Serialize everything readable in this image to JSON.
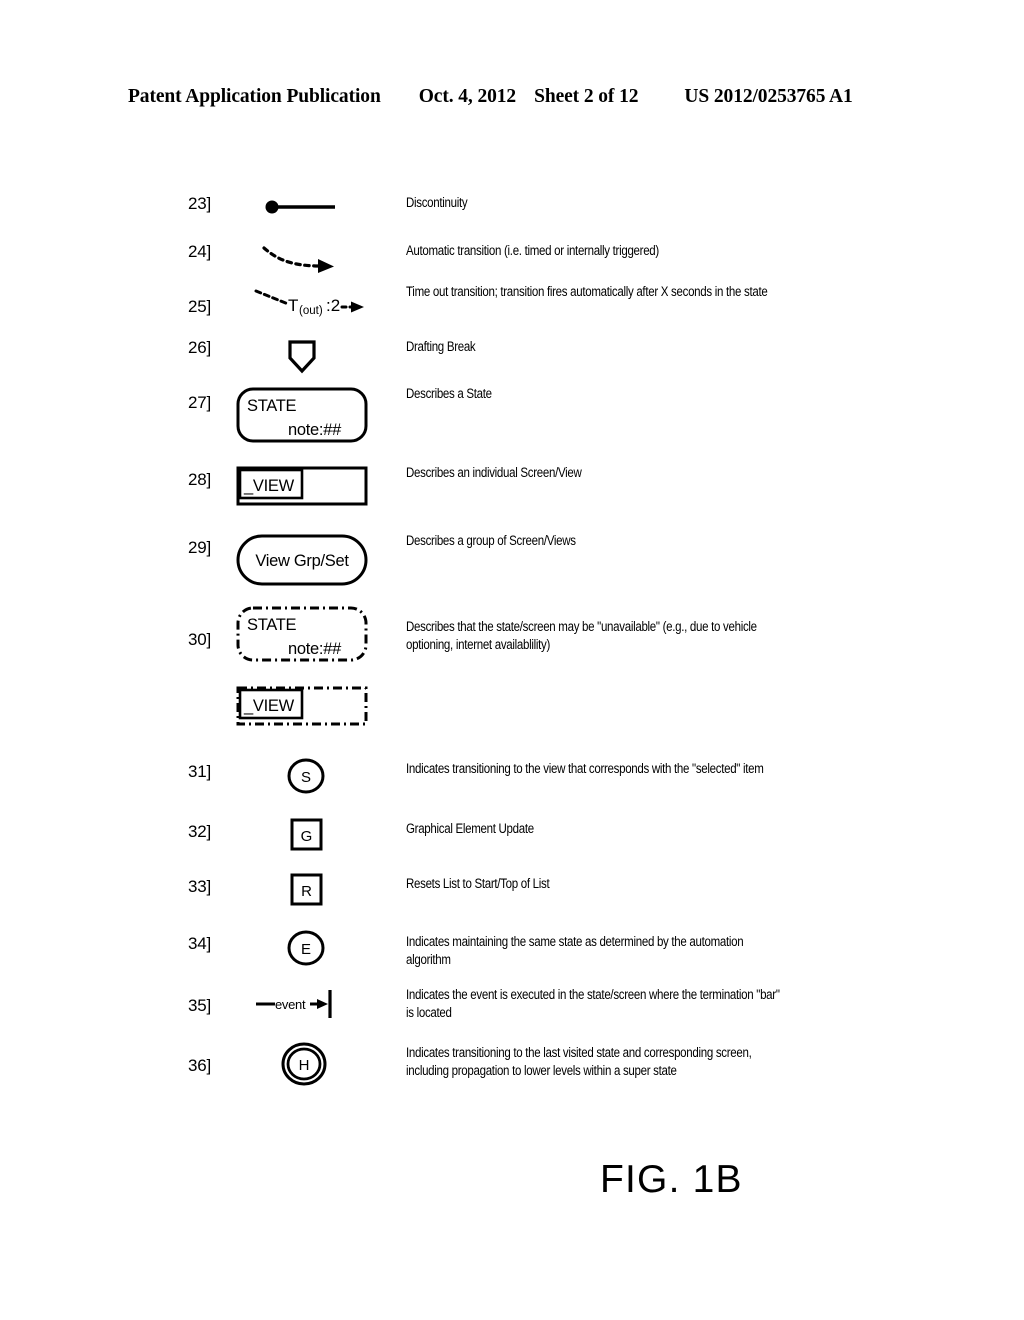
{
  "header": {
    "publication": "Patent Application Publication",
    "date": "Oct. 4, 2012",
    "sheet": "Sheet 2 of 12",
    "patent_number": "US 2012/0253765 A1"
  },
  "figure": {
    "caption": "FIG. 1B"
  },
  "legend": {
    "rows": [
      {
        "number": "23]",
        "symbol": "line-with-filled-dot",
        "description": "Discontinuity"
      },
      {
        "number": "24]",
        "symbol": "dashed-curved-arrow",
        "description": "Automatic transition (i.e. timed or internally triggered)"
      },
      {
        "number": "25]",
        "symbol": "timeout-transition-arrow",
        "symbol_text_main": "T",
        "symbol_text_sub": "(out)",
        "symbol_text_tail": ":2",
        "description": "Time out transition; transition fires automatically after X seconds in the state"
      },
      {
        "number": "26]",
        "symbol": "drafting-break-shield",
        "description": "Drafting Break"
      },
      {
        "number": "27]",
        "symbol": "state-rounded-box",
        "symbol_title": "STATE",
        "symbol_note": "note:##",
        "description": "Describes a State"
      },
      {
        "number": "28]",
        "symbol": "view-box",
        "symbol_title": "_VIEW",
        "description": "Describes an individual Screen/View"
      },
      {
        "number": "29]",
        "symbol": "view-group-stadium",
        "symbol_title": "View Grp/Set",
        "description": "Describes a group of Screen/Views"
      },
      {
        "number": "30]",
        "symbol": "dashed-state-and-view-boxes",
        "symbol_title": "STATE",
        "symbol_note": "note:##",
        "symbol_title2": "_VIEW",
        "description": "Describes that the state/screen may be \"unavailable\" (e.g., due to vehicle optioning, internet availablility)"
      },
      {
        "number": "31]",
        "symbol": "circle-letter",
        "symbol_letter": "S",
        "description": "Indicates transitioning to the view that corresponds with the \"selected\" item"
      },
      {
        "number": "32]",
        "symbol": "square-letter",
        "symbol_letter": "G",
        "description": "Graphical Element Update"
      },
      {
        "number": "33]",
        "symbol": "square-letter",
        "symbol_letter": "R",
        "description": "Resets List to Start/Top of List"
      },
      {
        "number": "34]",
        "symbol": "circle-letter",
        "symbol_letter": "E",
        "description": "Indicates maintaining the same state as determined by the automation algorithm"
      },
      {
        "number": "35]",
        "symbol": "event-arrow-termination-bar",
        "symbol_label": "event",
        "description": "Indicates the event is executed in the state/screen where the termination \"bar\" is located"
      },
      {
        "number": "36]",
        "symbol": "double-circle-letter",
        "symbol_letter": "H",
        "description": "Indicates transitioning to the last visited state and corresponding screen, including propagation to lower levels within a super state"
      }
    ]
  },
  "colors": {
    "ink": "#000000",
    "page": "#ffffff"
  }
}
